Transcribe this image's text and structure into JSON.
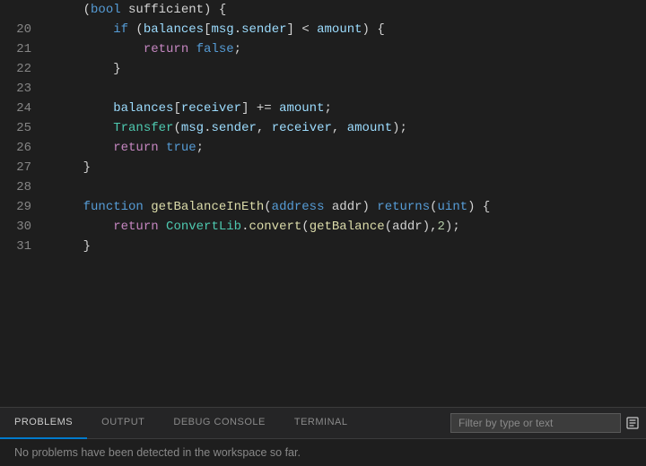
{
  "code": {
    "lines": [
      {
        "num": "",
        "tokens": [
          {
            "text": "    (",
            "class": "plain"
          },
          {
            "text": "bool",
            "class": "kw-blue"
          },
          {
            "text": " sufficient) {",
            "class": "plain"
          }
        ]
      },
      {
        "num": "20",
        "tokens": [
          {
            "text": "        ",
            "class": "plain"
          },
          {
            "text": "if",
            "class": "kw-blue"
          },
          {
            "text": " (",
            "class": "plain"
          },
          {
            "text": "balances",
            "class": "var-light"
          },
          {
            "text": "[",
            "class": "plain"
          },
          {
            "text": "msg",
            "class": "var-light"
          },
          {
            "text": ".",
            "class": "plain"
          },
          {
            "text": "sender",
            "class": "var-light"
          },
          {
            "text": "] < ",
            "class": "plain"
          },
          {
            "text": "amount",
            "class": "var-light"
          },
          {
            "text": ") {",
            "class": "plain"
          }
        ]
      },
      {
        "num": "21",
        "tokens": [
          {
            "text": "            ",
            "class": "plain"
          },
          {
            "text": "return",
            "class": "kw-purple"
          },
          {
            "text": " ",
            "class": "plain"
          },
          {
            "text": "false",
            "class": "kw-blue"
          },
          {
            "text": ";",
            "class": "plain"
          }
        ]
      },
      {
        "num": "22",
        "tokens": [
          {
            "text": "        }",
            "class": "plain"
          }
        ]
      },
      {
        "num": "23",
        "tokens": []
      },
      {
        "num": "24",
        "tokens": [
          {
            "text": "        ",
            "class": "plain"
          },
          {
            "text": "balances",
            "class": "var-light"
          },
          {
            "text": "[",
            "class": "plain"
          },
          {
            "text": "receiver",
            "class": "var-light"
          },
          {
            "text": "] += ",
            "class": "plain"
          },
          {
            "text": "amount",
            "class": "var-light"
          },
          {
            "text": ";",
            "class": "plain"
          }
        ]
      },
      {
        "num": "25",
        "tokens": [
          {
            "text": "        ",
            "class": "plain"
          },
          {
            "text": "Transfer",
            "class": "kw-green"
          },
          {
            "text": "(",
            "class": "plain"
          },
          {
            "text": "msg",
            "class": "var-light"
          },
          {
            "text": ".",
            "class": "plain"
          },
          {
            "text": "sender",
            "class": "var-light"
          },
          {
            "text": ", ",
            "class": "plain"
          },
          {
            "text": "receiver",
            "class": "var-light"
          },
          {
            "text": ", ",
            "class": "plain"
          },
          {
            "text": "amount",
            "class": "var-light"
          },
          {
            "text": ");",
            "class": "plain"
          }
        ]
      },
      {
        "num": "26",
        "tokens": [
          {
            "text": "        ",
            "class": "plain"
          },
          {
            "text": "return",
            "class": "kw-purple"
          },
          {
            "text": " ",
            "class": "plain"
          },
          {
            "text": "true",
            "class": "kw-blue"
          },
          {
            "text": ";",
            "class": "plain"
          }
        ]
      },
      {
        "num": "27",
        "tokens": [
          {
            "text": "    }",
            "class": "plain"
          }
        ]
      },
      {
        "num": "28",
        "tokens": []
      },
      {
        "num": "29",
        "tokens": [
          {
            "text": "    ",
            "class": "plain"
          },
          {
            "text": "function",
            "class": "kw-blue"
          },
          {
            "text": " ",
            "class": "plain"
          },
          {
            "text": "getBalanceInEth",
            "class": "kw-yellow"
          },
          {
            "text": "(",
            "class": "plain"
          },
          {
            "text": "address",
            "class": "kw-blue"
          },
          {
            "text": " addr) ",
            "class": "plain"
          },
          {
            "text": "returns",
            "class": "kw-blue"
          },
          {
            "text": "(",
            "class": "plain"
          },
          {
            "text": "uint",
            "class": "kw-blue"
          },
          {
            "text": ") {",
            "class": "plain"
          }
        ]
      },
      {
        "num": "30",
        "tokens": [
          {
            "text": "        ",
            "class": "plain"
          },
          {
            "text": "return",
            "class": "kw-purple"
          },
          {
            "text": " ",
            "class": "plain"
          },
          {
            "text": "ConvertLib",
            "class": "kw-green"
          },
          {
            "text": ".",
            "class": "plain"
          },
          {
            "text": "convert",
            "class": "kw-yellow"
          },
          {
            "text": "(",
            "class": "plain"
          },
          {
            "text": "getBalance",
            "class": "kw-yellow"
          },
          {
            "text": "(addr),",
            "class": "plain"
          },
          {
            "text": "2",
            "class": "num"
          },
          {
            "text": ");",
            "class": "plain"
          }
        ]
      },
      {
        "num": "31",
        "tokens": [
          {
            "text": "    }",
            "class": "plain"
          }
        ]
      }
    ]
  },
  "tabs": [
    {
      "id": "problems",
      "label": "PROBLEMS",
      "active": true
    },
    {
      "id": "output",
      "label": "OUTPUT",
      "active": false
    },
    {
      "id": "debug-console",
      "label": "DEBUG CONSOLE",
      "active": false
    },
    {
      "id": "terminal",
      "label": "TERMINAL",
      "active": false
    }
  ],
  "filter": {
    "placeholder": "Filter by type or text"
  },
  "status": {
    "message": "No problems have been detected in the workspace so far."
  },
  "icons": {
    "badge": "⊞"
  }
}
